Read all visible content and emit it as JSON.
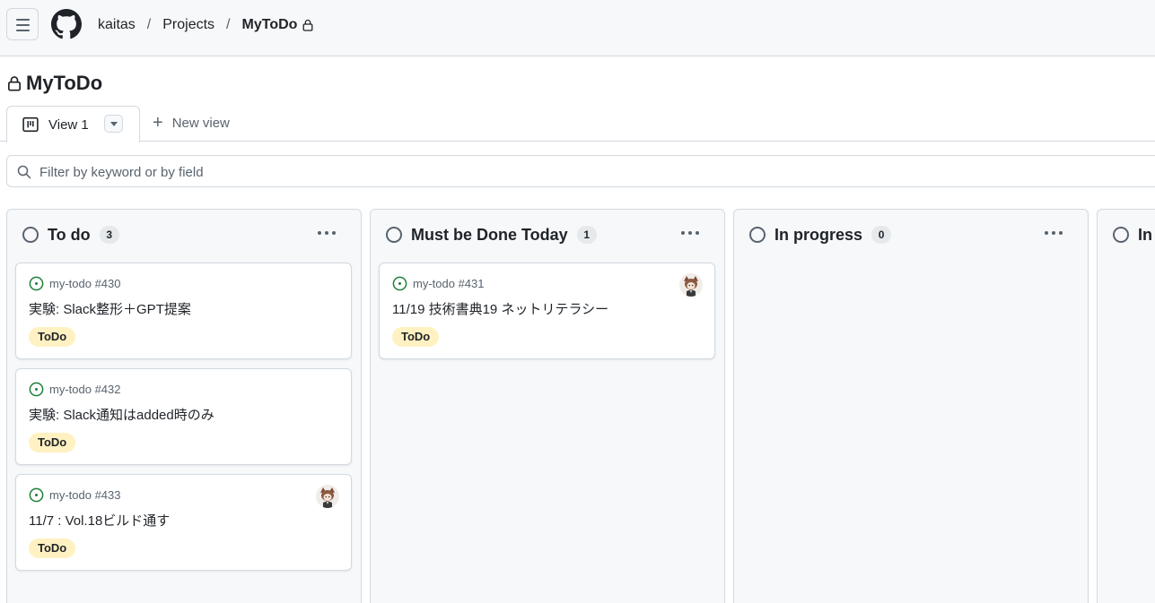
{
  "header": {
    "menu_icon": "hamburger-icon",
    "logo_icon": "github-logo-icon",
    "breadcrumb": {
      "owner": "kaitas",
      "section": "Projects",
      "project": "MyToDo",
      "separator": "/"
    },
    "lock_icon": "lock-icon"
  },
  "project": {
    "title": "MyToDo"
  },
  "views": {
    "active_tab": "View 1",
    "new_view_label": "New view",
    "board_icon": "board-icon"
  },
  "filter": {
    "placeholder": "Filter by keyword or by field",
    "value": ""
  },
  "columns": [
    {
      "name": "To do",
      "count": "3",
      "cards": [
        {
          "issue": "my-todo #430",
          "title": "実験: Slack整形＋GPT提案",
          "label": "ToDo",
          "assignee_avatar": false
        },
        {
          "issue": "my-todo #432",
          "title": "実験: Slack通知はadded時のみ",
          "label": "ToDo",
          "assignee_avatar": false
        },
        {
          "issue": "my-todo #433",
          "title": "11/7 : Vol.18ビルド通す",
          "label": "ToDo",
          "assignee_avatar": true
        }
      ]
    },
    {
      "name": "Must be Done Today",
      "count": "1",
      "cards": [
        {
          "issue": "my-todo #431",
          "title": "11/19 技術書典19 ネットリテラシー",
          "label": "ToDo",
          "assignee_avatar": true
        }
      ]
    },
    {
      "name": "In progress",
      "count": "0",
      "cards": []
    },
    {
      "name": "In",
      "count": "",
      "cards": []
    }
  ],
  "colors": {
    "label_todo_bg": "#fff1c1",
    "open_issue": "#1a7f37",
    "border": "#d1d9e0"
  }
}
